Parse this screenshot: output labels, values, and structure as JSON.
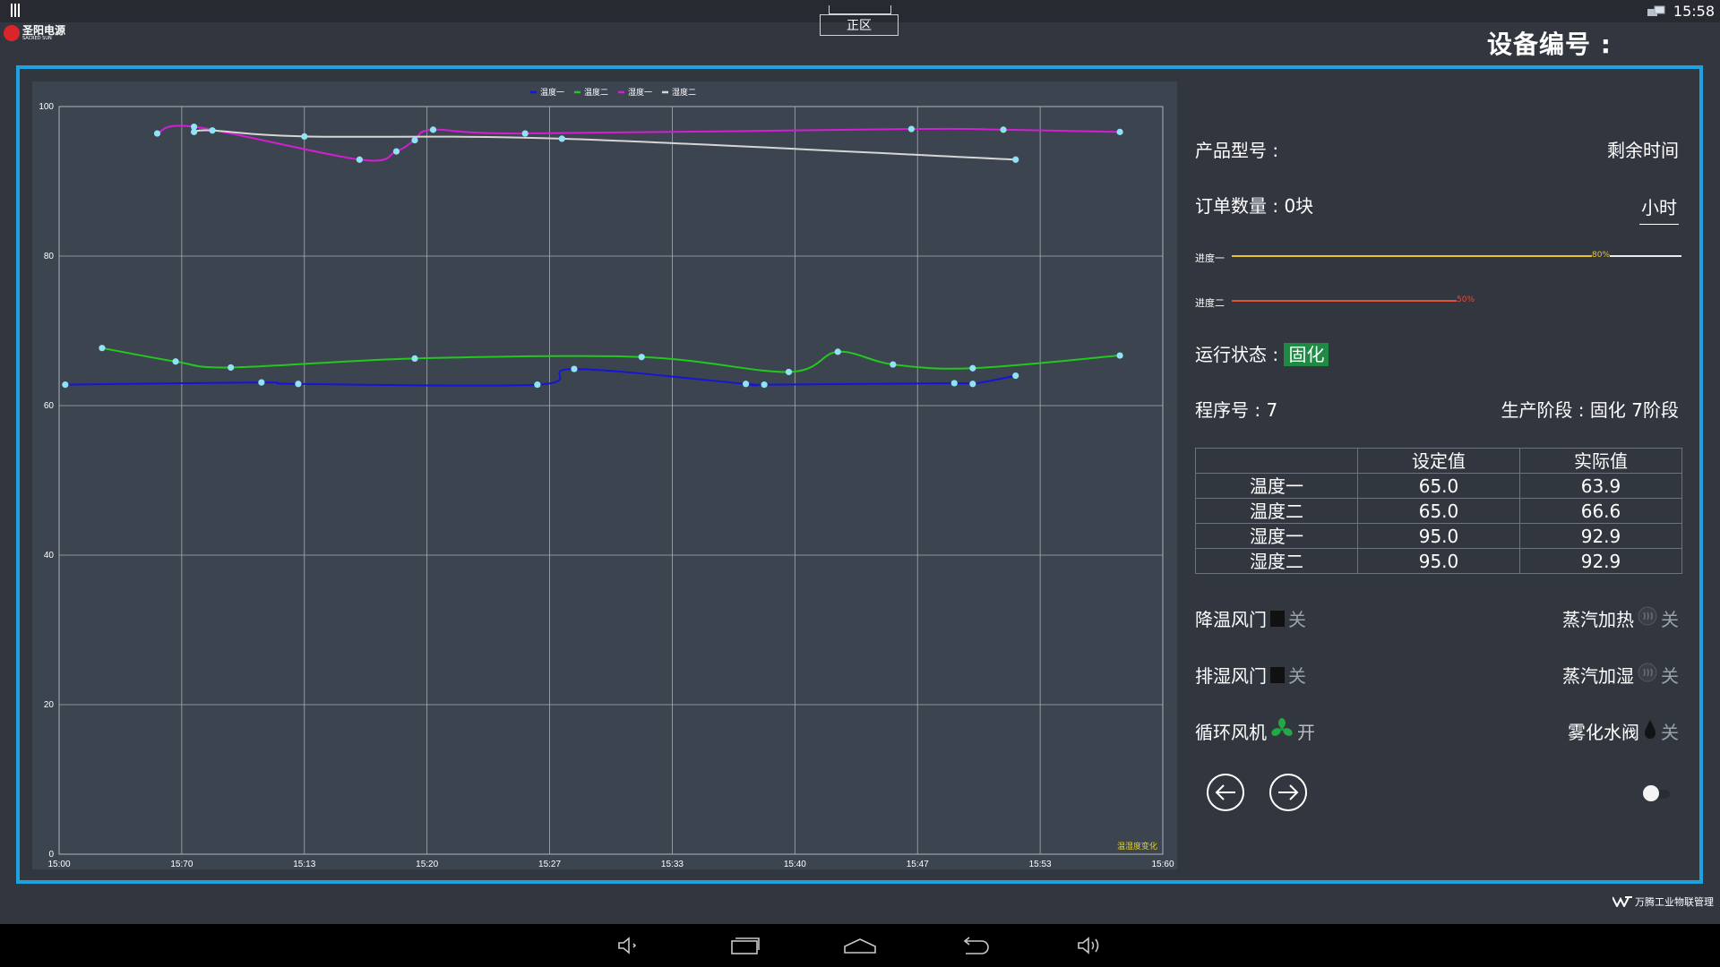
{
  "status_bar": {
    "time": "15:58"
  },
  "brand": {
    "name_cn": "圣阳电源",
    "name_en": "SACRED SUN"
  },
  "zone_tab": "正区",
  "device_no_label": "设备编号 :",
  "chart_data": {
    "type": "line",
    "legend": [
      "温度一",
      "温度二",
      "湿度一",
      "湿度二"
    ],
    "legend_placement": "top-center",
    "chart_label": "温湿度变化",
    "x_tick_labels": [
      "15:00",
      "15:70",
      "15:13",
      "15:20",
      "15:27",
      "15:33",
      "15:40",
      "15:47",
      "15:53",
      "15:60"
    ],
    "ylim": [
      0,
      100
    ],
    "y_ticks": [
      0,
      20,
      40,
      60,
      80,
      100
    ],
    "grid": true,
    "series": [
      {
        "name": "温度一",
        "color": "#1515d8",
        "points": [
          [
            0.05,
            62.8
          ],
          [
            1.65,
            63.1
          ],
          [
            1.95,
            62.9
          ],
          [
            3.9,
            62.8
          ],
          [
            4.2,
            64.9
          ],
          [
            5.6,
            62.9
          ],
          [
            5.75,
            62.8
          ],
          [
            7.3,
            63.0
          ],
          [
            7.45,
            62.9
          ],
          [
            7.8,
            64.0
          ]
        ]
      },
      {
        "name": "温度二",
        "color": "#22c81e",
        "points": [
          [
            0.35,
            67.7
          ],
          [
            0.95,
            65.9
          ],
          [
            1.4,
            65.1
          ],
          [
            2.9,
            66.3
          ],
          [
            4.75,
            66.5
          ],
          [
            5.95,
            64.5
          ],
          [
            6.35,
            67.2
          ],
          [
            6.8,
            65.5
          ],
          [
            7.45,
            65.0
          ],
          [
            8.65,
            66.7
          ]
        ]
      },
      {
        "name": "湿度一",
        "color": "#d41ed4",
        "points": [
          [
            0.8,
            96.4
          ],
          [
            1.1,
            97.3
          ],
          [
            2.45,
            92.9
          ],
          [
            2.75,
            94.0
          ],
          [
            2.9,
            95.5
          ],
          [
            3.05,
            96.9
          ],
          [
            3.8,
            96.4
          ],
          [
            6.95,
            97.0
          ],
          [
            7.7,
            96.9
          ],
          [
            8.65,
            96.6
          ]
        ]
      },
      {
        "name": "湿度二",
        "color": "#d6d6d6",
        "points": [
          [
            1.1,
            96.6
          ],
          [
            1.25,
            96.8
          ],
          [
            2.0,
            96.0
          ],
          [
            4.1,
            95.7
          ],
          [
            7.8,
            92.9
          ]
        ]
      }
    ]
  },
  "info": {
    "product_model_label": "产品型号 :",
    "remaining_time_label": "剩余时间",
    "order_qty_label": "订单数量 : 0块",
    "hours_unit": "小时",
    "progress": [
      {
        "label": "进度一",
        "value": 80,
        "text": "80%",
        "color": "#e8c22a"
      },
      {
        "label": "进度二",
        "value": 50,
        "text": "50%",
        "color": "#e0503a"
      }
    ],
    "run_status_label": "运行状态 :",
    "run_status_value": "固化",
    "program_no": "程序号 : 7",
    "stage": "生产阶段 : 固化 7阶段"
  },
  "params_table": {
    "headers": [
      "",
      "设定值",
      "实际值"
    ],
    "rows": [
      [
        "温度一",
        "65.0",
        "63.9"
      ],
      [
        "温度二",
        "65.0",
        "66.6"
      ],
      [
        "湿度一",
        "95.0",
        "92.9"
      ],
      [
        "湿度二",
        "95.0",
        "92.9"
      ]
    ]
  },
  "devices": {
    "cooling_damper": {
      "label": "降温风门",
      "state": "关"
    },
    "steam_heat": {
      "label": "蒸汽加热",
      "state": "关"
    },
    "exhaust_damper": {
      "label": "排湿风门",
      "state": "关"
    },
    "steam_humid": {
      "label": "蒸汽加湿",
      "state": "关"
    },
    "circ_fan": {
      "label": "循环风机",
      "state": "开"
    },
    "mist_valve": {
      "label": "雾化水阀",
      "state": "关"
    }
  },
  "footer_brand": "万腾工业物联管理",
  "colors": {
    "frame": "#1aa3e0",
    "status_green": "#1e8a44"
  }
}
